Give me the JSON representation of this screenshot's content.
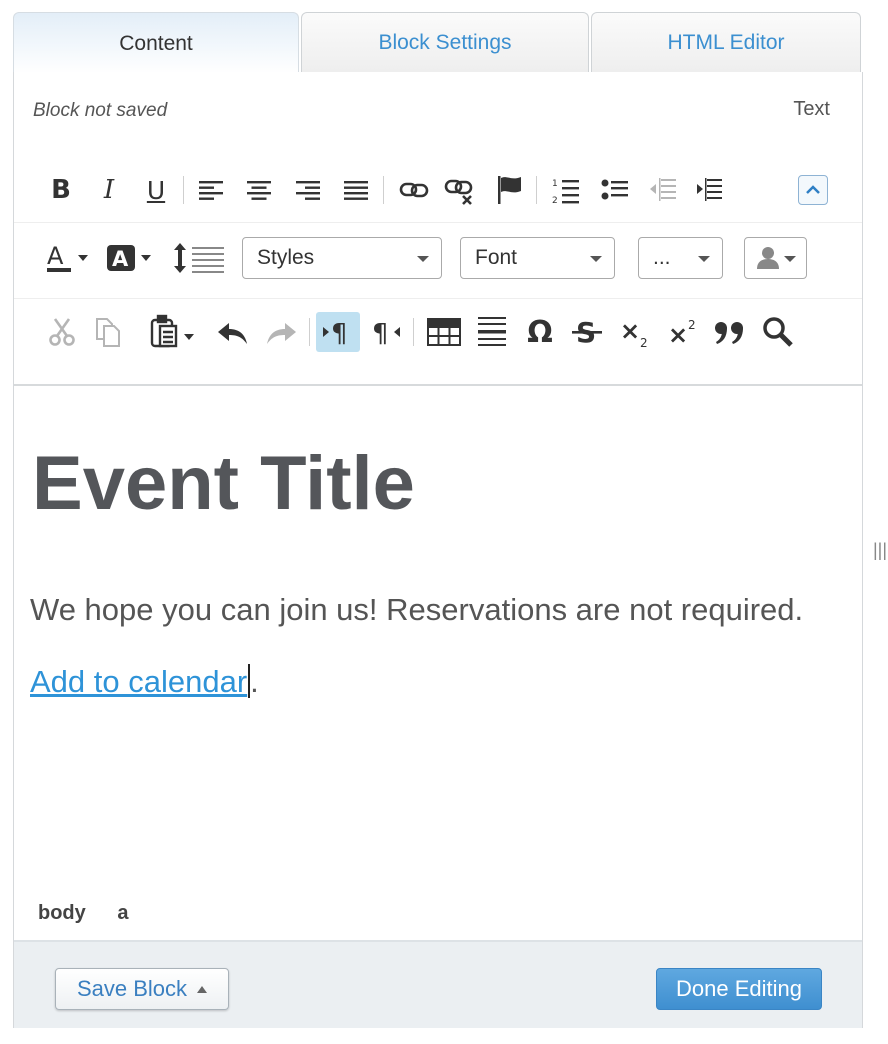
{
  "tabs": [
    {
      "label": "Content",
      "active": true
    },
    {
      "label": "Block Settings",
      "active": false
    },
    {
      "label": "HTML Editor",
      "active": false
    }
  ],
  "status": "Block not saved",
  "mode": "Text",
  "toolbar": {
    "row1": [
      "bold-icon",
      "italic-icon",
      "underline-icon",
      "align-left-icon",
      "align-center-icon",
      "align-right-icon",
      "align-justify-icon",
      "link-icon",
      "unlink-icon",
      "anchor-flag-icon",
      "numbered-list-icon",
      "bulleted-list-icon",
      "outdent-icon",
      "indent-icon",
      "collapse-toolbar-icon"
    ],
    "row2": {
      "styles": "Styles",
      "font": "Font",
      "size": "...",
      "icons": [
        "text-color-icon",
        "background-color-icon",
        "line-height-icon",
        "personalize-icon"
      ]
    },
    "row3": [
      "cut-icon",
      "copy-icon",
      "paste-icon",
      "undo-icon",
      "redo-icon",
      "ltr-icon",
      "rtl-icon",
      "table-icon",
      "horizontal-rule-icon",
      "special-char-icon",
      "strikethrough-icon",
      "subscript-icon",
      "superscript-icon",
      "blockquote-icon",
      "find-icon"
    ]
  },
  "content": {
    "title": "Event Title",
    "paragraph": "We hope you can join us! Reservations are not required.",
    "link_text": "Add to calendar",
    "after_link": "."
  },
  "element_path": [
    "body",
    "a"
  ],
  "footer": {
    "save_label": "Save Block",
    "done_label": "Done Editing"
  },
  "colors": {
    "accent": "#3b8fd0",
    "link": "#2e93d8",
    "title": "#54565a",
    "done_button": "#4a98d6"
  }
}
